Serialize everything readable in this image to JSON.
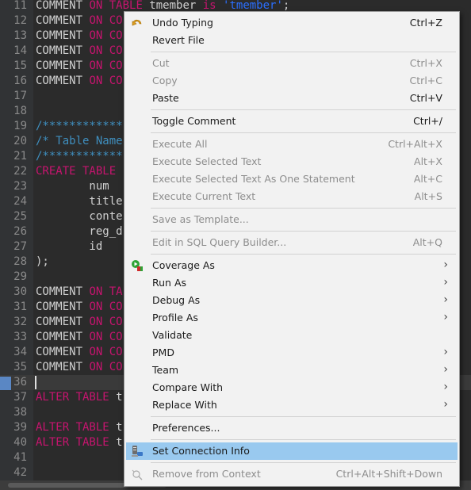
{
  "editor": {
    "lines": [
      {
        "n": "11",
        "tokens": [
          {
            "t": "COMMENT ",
            "c": "pl"
          },
          {
            "t": "ON TABLE ",
            "c": "kw"
          },
          {
            "t": "tmember ",
            "c": "pl"
          },
          {
            "t": "is ",
            "c": "kw"
          },
          {
            "t": "'tmember'",
            "c": "st"
          },
          {
            "t": ";",
            "c": "pl"
          }
        ]
      },
      {
        "n": "12",
        "tokens": [
          {
            "t": "COMMENT ",
            "c": "pl"
          },
          {
            "t": "ON CO",
            "c": "kw"
          }
        ]
      },
      {
        "n": "13",
        "tokens": [
          {
            "t": "COMMENT ",
            "c": "pl"
          },
          {
            "t": "ON CO",
            "c": "kw"
          }
        ]
      },
      {
        "n": "14",
        "tokens": [
          {
            "t": "COMMENT ",
            "c": "pl"
          },
          {
            "t": "ON CO",
            "c": "kw"
          }
        ]
      },
      {
        "n": "15",
        "tokens": [
          {
            "t": "COMMENT ",
            "c": "pl"
          },
          {
            "t": "ON CO",
            "c": "kw"
          }
        ]
      },
      {
        "n": "16",
        "tokens": [
          {
            "t": "COMMENT ",
            "c": "pl"
          },
          {
            "t": "ON CO",
            "c": "kw"
          }
        ]
      },
      {
        "n": "17",
        "tokens": []
      },
      {
        "n": "18",
        "tokens": []
      },
      {
        "n": "19",
        "tokens": [
          {
            "t": "/************",
            "c": "cm"
          }
        ]
      },
      {
        "n": "20",
        "tokens": [
          {
            "t": "/* Table Name",
            "c": "cm"
          }
        ]
      },
      {
        "n": "21",
        "tokens": [
          {
            "t": "/************",
            "c": "cm"
          }
        ]
      },
      {
        "n": "22",
        "tokens": [
          {
            "t": "CREATE TABLE ",
            "c": "kw"
          }
        ]
      },
      {
        "n": "23",
        "tokens": [
          {
            "t": "        num",
            "c": "pl"
          }
        ]
      },
      {
        "n": "24",
        "tokens": [
          {
            "t": "        title",
            "c": "pl"
          }
        ]
      },
      {
        "n": "25",
        "tokens": [
          {
            "t": "        conte",
            "c": "pl"
          }
        ]
      },
      {
        "n": "26",
        "tokens": [
          {
            "t": "        reg_d",
            "c": "pl"
          }
        ]
      },
      {
        "n": "27",
        "tokens": [
          {
            "t": "        id",
            "c": "pl"
          }
        ]
      },
      {
        "n": "28",
        "tokens": [
          {
            "t": ");",
            "c": "pl"
          }
        ]
      },
      {
        "n": "29",
        "tokens": []
      },
      {
        "n": "30",
        "tokens": [
          {
            "t": "COMMENT ",
            "c": "pl"
          },
          {
            "t": "ON TA",
            "c": "kw"
          }
        ]
      },
      {
        "n": "31",
        "tokens": [
          {
            "t": "COMMENT ",
            "c": "pl"
          },
          {
            "t": "ON CO",
            "c": "kw"
          }
        ]
      },
      {
        "n": "32",
        "tokens": [
          {
            "t": "COMMENT ",
            "c": "pl"
          },
          {
            "t": "ON CO",
            "c": "kw"
          }
        ]
      },
      {
        "n": "33",
        "tokens": [
          {
            "t": "COMMENT ",
            "c": "pl"
          },
          {
            "t": "ON CO",
            "c": "kw"
          }
        ]
      },
      {
        "n": "34",
        "tokens": [
          {
            "t": "COMMENT ",
            "c": "pl"
          },
          {
            "t": "ON CO",
            "c": "kw"
          }
        ]
      },
      {
        "n": "35",
        "tokens": [
          {
            "t": "COMMENT ",
            "c": "pl"
          },
          {
            "t": "ON CO",
            "c": "kw"
          }
        ]
      },
      {
        "n": "36",
        "tokens": [],
        "current": true
      },
      {
        "n": "37",
        "tokens": [
          {
            "t": "ALTER TABLE ",
            "c": "kw"
          },
          {
            "t": "t",
            "c": "pl"
          }
        ]
      },
      {
        "n": "38",
        "tokens": []
      },
      {
        "n": "39",
        "tokens": [
          {
            "t": "ALTER TABLE ",
            "c": "kw"
          },
          {
            "t": "t",
            "c": "pl"
          }
        ]
      },
      {
        "n": "40",
        "tokens": [
          {
            "t": "ALTER TABLE ",
            "c": "kw"
          },
          {
            "t": "t",
            "c": "pl"
          }
        ]
      },
      {
        "n": "41",
        "tokens": []
      },
      {
        "n": "42",
        "tokens": []
      }
    ]
  },
  "context_menu": {
    "items": [
      {
        "type": "item",
        "label": "Undo Typing",
        "shortcut": "Ctrl+Z",
        "icon": "undo-icon"
      },
      {
        "type": "item",
        "label": "Revert File"
      },
      {
        "type": "sep"
      },
      {
        "type": "item",
        "label": "Cut",
        "shortcut": "Ctrl+X",
        "disabled": true
      },
      {
        "type": "item",
        "label": "Copy",
        "shortcut": "Ctrl+C",
        "disabled": true
      },
      {
        "type": "item",
        "label": "Paste",
        "shortcut": "Ctrl+V"
      },
      {
        "type": "sep"
      },
      {
        "type": "item",
        "label": "Toggle Comment",
        "shortcut": "Ctrl+/"
      },
      {
        "type": "sep"
      },
      {
        "type": "item",
        "label": "Execute All",
        "shortcut": "Ctrl+Alt+X",
        "disabled": true
      },
      {
        "type": "item",
        "label": "Execute Selected Text",
        "shortcut": "Alt+X",
        "disabled": true
      },
      {
        "type": "item",
        "label": "Execute Selected Text As One Statement",
        "shortcut": "Alt+C",
        "disabled": true
      },
      {
        "type": "item",
        "label": "Execute Current Text",
        "shortcut": "Alt+S",
        "disabled": true
      },
      {
        "type": "sep"
      },
      {
        "type": "item",
        "label": "Save as Template...",
        "disabled": true
      },
      {
        "type": "sep"
      },
      {
        "type": "item",
        "label": "Edit in SQL Query Builder...",
        "shortcut": "Alt+Q",
        "disabled": true
      },
      {
        "type": "sep"
      },
      {
        "type": "item",
        "label": "Coverage As",
        "submenu": true,
        "icon": "coverage-icon"
      },
      {
        "type": "item",
        "label": "Run As",
        "submenu": true
      },
      {
        "type": "item",
        "label": "Debug As",
        "submenu": true
      },
      {
        "type": "item",
        "label": "Profile As",
        "submenu": true
      },
      {
        "type": "item",
        "label": "Validate"
      },
      {
        "type": "item",
        "label": "PMD",
        "submenu": true
      },
      {
        "type": "item",
        "label": "Team",
        "submenu": true
      },
      {
        "type": "item",
        "label": "Compare With",
        "submenu": true
      },
      {
        "type": "item",
        "label": "Replace With",
        "submenu": true
      },
      {
        "type": "sep"
      },
      {
        "type": "item",
        "label": "Preferences..."
      },
      {
        "type": "sep"
      },
      {
        "type": "item",
        "label": "Set Connection Info",
        "highlight": true,
        "icon": "connection-icon"
      },
      {
        "type": "sep"
      },
      {
        "type": "item",
        "label": "Remove from Context",
        "shortcut": "Ctrl+Alt+Shift+Down",
        "disabled": true,
        "icon": "remove-context-icon"
      }
    ]
  },
  "colors": {
    "keyword": "#c7146f",
    "comment": "#3f8fbf",
    "string": "#2b6fff",
    "menu_highlight": "#99c9ef"
  }
}
